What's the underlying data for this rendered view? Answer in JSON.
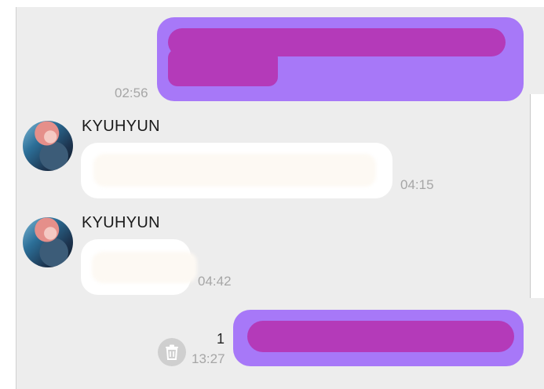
{
  "chat": {
    "messages": [
      {
        "direction": "outgoing",
        "time": "02:56"
      },
      {
        "direction": "incoming",
        "sender": "KYUHYUN",
        "time": "04:15"
      },
      {
        "direction": "incoming",
        "sender": "KYUHYUN",
        "time": "04:42"
      },
      {
        "direction": "outgoing",
        "time": "13:27",
        "unread_count": "1"
      }
    ]
  },
  "colors": {
    "outgoing_bubble": "#a778f8",
    "redaction_mark": "#b43ab9",
    "incoming_bubble": "#ffffff",
    "background": "#ededed"
  },
  "icons": {
    "delete": "trash-icon",
    "avatar": "contact-avatar"
  }
}
